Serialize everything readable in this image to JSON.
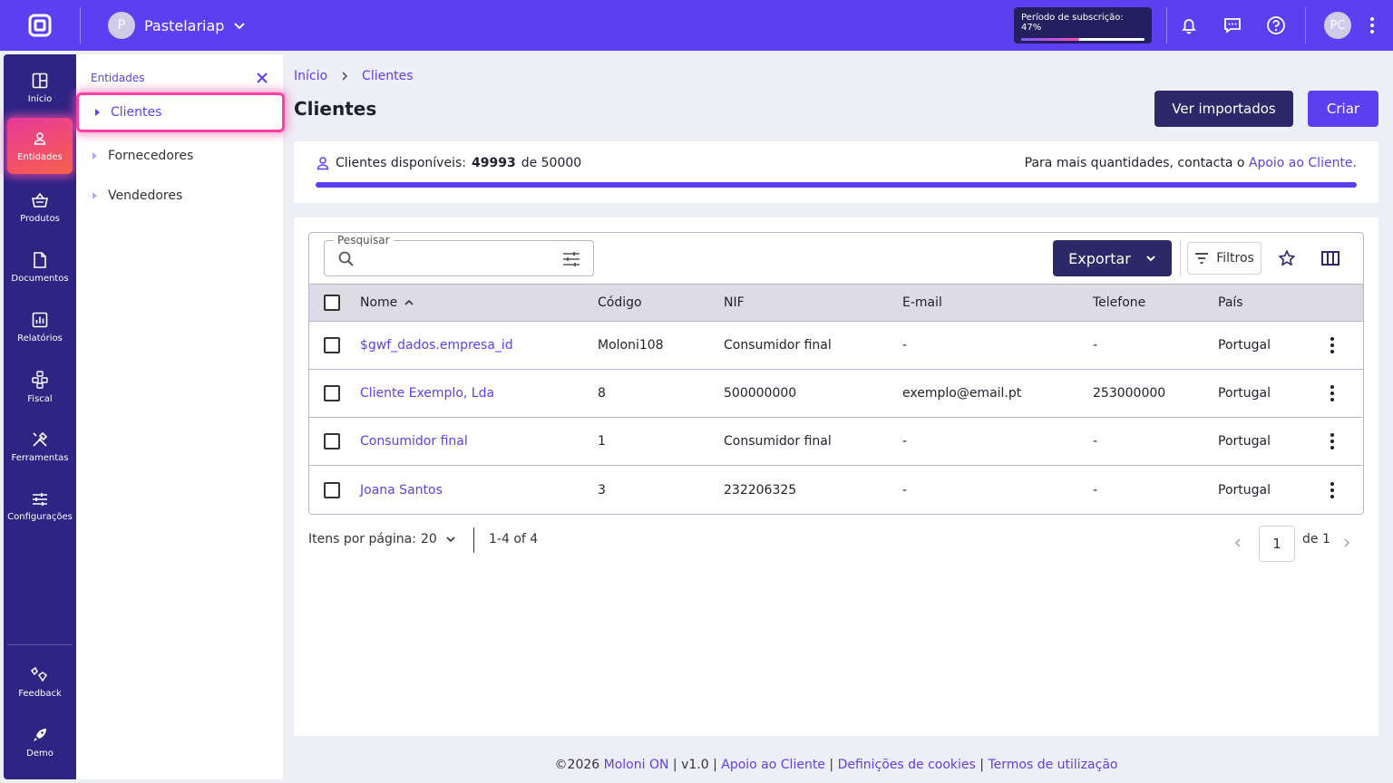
{
  "topbar": {
    "company_initial": "P",
    "company_name": "Pastelariap",
    "subscription_label": "Período de subscrição: 47%",
    "subscription_progress": 0.47,
    "user_initials": "PC"
  },
  "nav": {
    "items": [
      {
        "label": "Início",
        "icon": "dashboard-icon"
      },
      {
        "label": "Entidades",
        "icon": "person-icon"
      },
      {
        "label": "Produtos",
        "icon": "basket-icon"
      },
      {
        "label": "Documentos",
        "icon": "document-icon"
      },
      {
        "label": "Relatórios",
        "icon": "report-icon"
      },
      {
        "label": "Fiscal",
        "icon": "fiscal-icon"
      },
      {
        "label": "Ferramentas",
        "icon": "tools-icon"
      },
      {
        "label": "Configurações",
        "icon": "settings-icon"
      }
    ],
    "bottom": [
      {
        "label": "Feedback",
        "icon": "feedback-icon"
      },
      {
        "label": "Demo",
        "icon": "rocket-icon"
      }
    ],
    "active_index": 1
  },
  "subpanel": {
    "title": "Entidades",
    "items": [
      "Clientes",
      "Fornecedores",
      "Vendedores"
    ],
    "active_index": 0
  },
  "breadcrumb": {
    "home": "Início",
    "current": "Clientes"
  },
  "page": {
    "title": "Clientes",
    "btn_imported": "Ver importados",
    "btn_create": "Criar"
  },
  "quota": {
    "label": "Clientes disponíveis:",
    "available": "49993",
    "of": "de 50000",
    "more_text": "Para mais quantidades, contacta o",
    "more_link": "Apoio ao Cliente."
  },
  "toolbar": {
    "search_label": "Pesquisar",
    "search_value": "",
    "export_label": "Exportar",
    "filters_label": "Filtros"
  },
  "table": {
    "headers": [
      "Nome",
      "Código",
      "NIF",
      "E-mail",
      "Telefone",
      "País"
    ],
    "rows": [
      {
        "nome": "$gwf_dados.empresa_id",
        "codigo": "Moloni108",
        "nif": "Consumidor final",
        "email": "-",
        "telefone": "-",
        "pais": "Portugal"
      },
      {
        "nome": "Cliente Exemplo, Lda",
        "codigo": "8",
        "nif": "500000000",
        "email": "exemplo@email.pt",
        "telefone": "253000000",
        "pais": "Portugal"
      },
      {
        "nome": "Consumidor final",
        "codigo": "1",
        "nif": "Consumidor final",
        "email": "-",
        "telefone": "-",
        "pais": "Portugal"
      },
      {
        "nome": "Joana Santos",
        "codigo": "3",
        "nif": "232206325",
        "email": "-",
        "telefone": "-",
        "pais": "Portugal"
      }
    ]
  },
  "pager": {
    "per_page_label": "Itens por página:",
    "per_page": "20",
    "range": "1-4 of 4",
    "page": "1",
    "of_pages": "de 1"
  },
  "footer": {
    "copyright": "©2026",
    "brand": "Moloni ON",
    "version": "v1.0",
    "support": "Apoio ao Cliente",
    "cookies": "Definições de cookies",
    "terms": "Termos de utilização",
    "sep": "|"
  },
  "colors": {
    "primary": "#5b3ff0",
    "navy": "#2e2483",
    "dark_button": "#2b2968",
    "active_gradient_start": "#e6399b",
    "active_gradient_end": "#f7604a"
  }
}
